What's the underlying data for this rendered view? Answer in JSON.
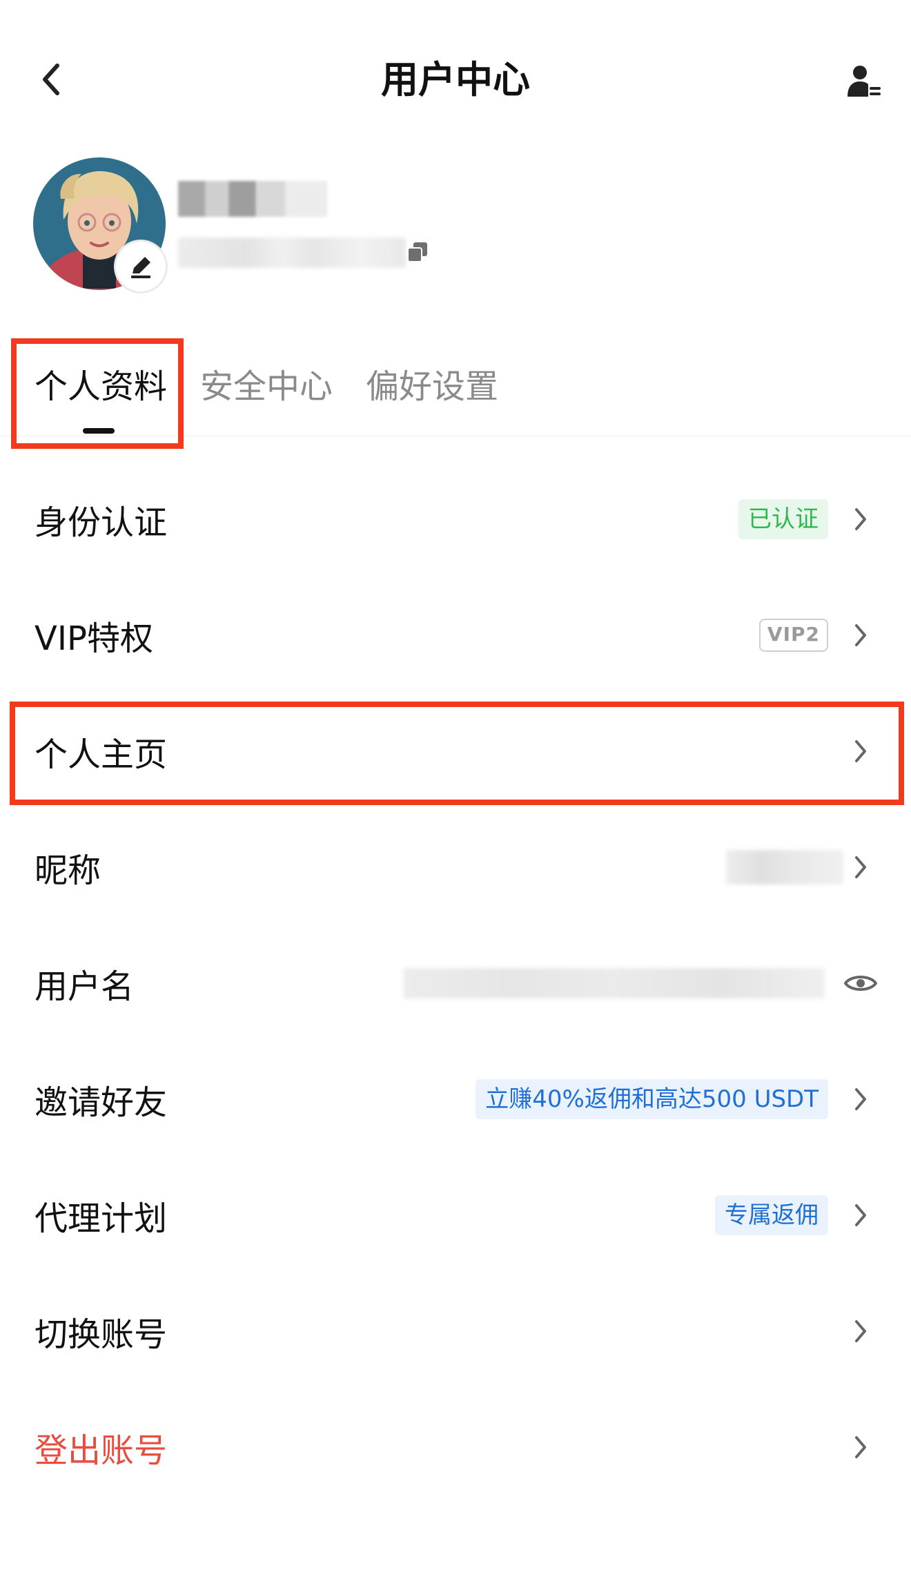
{
  "header": {
    "title": "用户中心",
    "back_icon": "chevron-left-icon",
    "switch_user_icon": "user-switch-icon"
  },
  "profile": {
    "avatar_icon": "avatar-image",
    "edit_icon": "pencil-icon",
    "copy_icon": "copy-icon"
  },
  "tabs": [
    {
      "label": "个人资料",
      "active": true
    },
    {
      "label": "安全中心",
      "active": false
    },
    {
      "label": "偏好设置",
      "active": false
    }
  ],
  "menu": {
    "identity": {
      "label": "身份认证",
      "badge": "已认证"
    },
    "vip": {
      "label": "VIP特权",
      "badge": "VIP2"
    },
    "homepage": {
      "label": "个人主页"
    },
    "nickname": {
      "label": "昵称"
    },
    "username": {
      "label": "用户名",
      "eye_icon": "eye-icon"
    },
    "invite": {
      "label": "邀请好友",
      "badge": "立赚40%返佣和高达500 USDT"
    },
    "agent": {
      "label": "代理计划",
      "badge": "专属返佣"
    },
    "switch_account": {
      "label": "切换账号"
    },
    "logout": {
      "label": "登出账号"
    }
  },
  "colors": {
    "highlight": "#f23a1f",
    "verified_green": "#2fb84f",
    "link_blue": "#1f6fd6",
    "danger_red": "#e84e3f"
  }
}
